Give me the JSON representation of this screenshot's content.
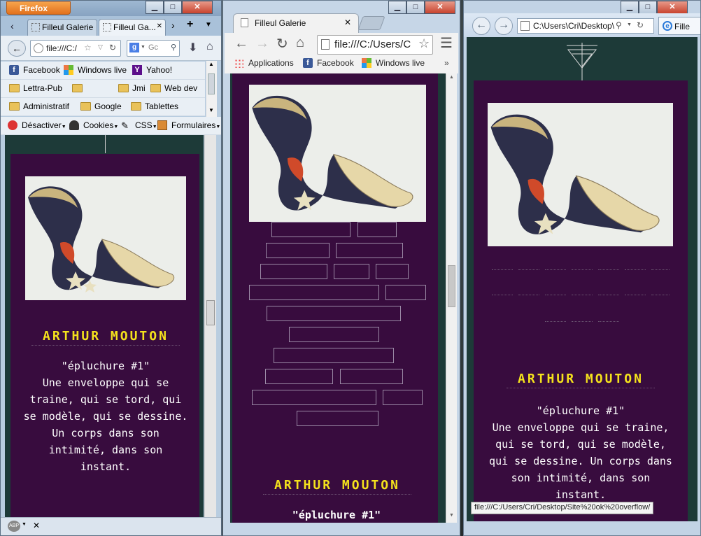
{
  "firefox": {
    "menu_button": "Firefox",
    "tabs": [
      "Filleul Galerie",
      "Filleul Ga..."
    ],
    "url": "file:///C:/",
    "search_placeholder": "Gc",
    "bookmarks_row1": [
      "Facebook",
      "Windows live",
      "Yahoo!"
    ],
    "bookmarks_row2": [
      "Lettra-Pub",
      "",
      "Jmi",
      "Web dev"
    ],
    "bookmarks_row3": [
      "Administratif",
      "Google",
      "Tablettes"
    ],
    "dev_toolbar": [
      "Désactiver",
      "Cookies",
      "CSS",
      "Formulaires"
    ],
    "status_addon": "ABP"
  },
  "chrome": {
    "tab_title": "Filleul Galerie",
    "url": "file:///C:/Users/C",
    "bookmarks": [
      "Applications",
      "Facebook",
      "Windows live"
    ]
  },
  "ie": {
    "url": "C:\\Users\\Cri\\Desktop\\",
    "tab_title": "Fille",
    "status_url": "file:///C:/Users/Cri/Desktop/Site%20ok%20overflow/"
  },
  "page": {
    "artist": "ARTHUR MOUTON",
    "piece_title": "\"épluchure #1\"",
    "description": "Une enveloppe qui se traine, qui se tord, qui se modèle, qui se dessine. Un corps dans son intimité, dans son instant."
  },
  "colors": {
    "page_bg": "#1d3a38",
    "panel_bg": "#380c3e",
    "artist_yellow": "#f4e21c"
  }
}
